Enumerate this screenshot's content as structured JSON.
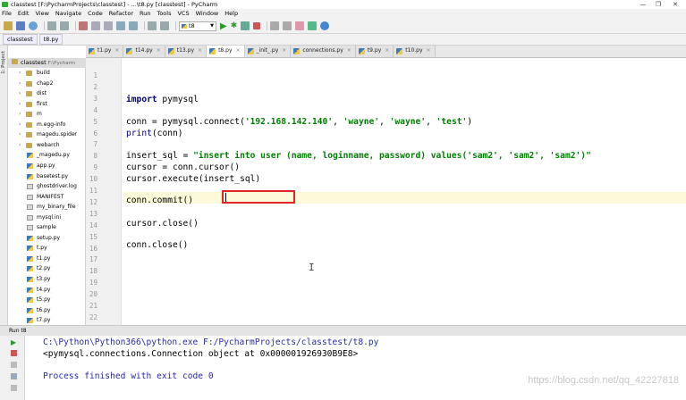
{
  "window": {
    "title": "classtest [F:\\PycharmProjects\\classtest] - ...\\t8.py [classtest] - PyCharm",
    "controls": [
      "—",
      "❐",
      "✕"
    ]
  },
  "menu": [
    "File",
    "Edit",
    "View",
    "Navigate",
    "Code",
    "Refactor",
    "Run",
    "Tools",
    "VCS",
    "Window",
    "Help"
  ],
  "toolbar": {
    "run_config": "t8"
  },
  "breadcrumbs": [
    "classtest",
    "t8.py"
  ],
  "left_strip": {
    "label": "1: Project"
  },
  "tabs": [
    {
      "label": "t1.py",
      "active": false
    },
    {
      "label": "t14.py",
      "active": false
    },
    {
      "label": "t13.py",
      "active": false
    },
    {
      "label": "t8.py",
      "active": true
    },
    {
      "label": "_init_.py",
      "active": false
    },
    {
      "label": "connections.py",
      "active": false
    },
    {
      "label": "t9.py",
      "active": false
    },
    {
      "label": "t10.py",
      "active": false
    }
  ],
  "project": {
    "root": "classtest",
    "root_path": "F:\\Pycharm",
    "items": [
      {
        "label": "build",
        "type": "folder"
      },
      {
        "label": "chap2",
        "type": "folder"
      },
      {
        "label": "dist",
        "type": "folder"
      },
      {
        "label": "first",
        "type": "folder"
      },
      {
        "label": "m",
        "type": "folder"
      },
      {
        "label": "m.egg-info",
        "type": "folder"
      },
      {
        "label": "magedu.spider",
        "type": "folder"
      },
      {
        "label": "webarch",
        "type": "folder"
      },
      {
        "label": "_magedu.py",
        "type": "py"
      },
      {
        "label": "app.py",
        "type": "py"
      },
      {
        "label": "basetest.py",
        "type": "py"
      },
      {
        "label": "ghostdriver.log",
        "type": "txt"
      },
      {
        "label": "MANIFEST",
        "type": "txt"
      },
      {
        "label": "my_binary_file",
        "type": "txt"
      },
      {
        "label": "mysql.ini",
        "type": "txt"
      },
      {
        "label": "sample",
        "type": "txt"
      },
      {
        "label": "setup.py",
        "type": "py"
      },
      {
        "label": "t.py",
        "type": "py"
      },
      {
        "label": "t1.py",
        "type": "py"
      },
      {
        "label": "t2.py",
        "type": "py"
      },
      {
        "label": "t3.py",
        "type": "py"
      },
      {
        "label": "t4.py",
        "type": "py"
      },
      {
        "label": "t5.py",
        "type": "py"
      },
      {
        "label": "t6.py",
        "type": "py"
      },
      {
        "label": "t7.py",
        "type": "py"
      }
    ]
  },
  "editor": {
    "line_numbers": [
      "1",
      "2",
      "3",
      "4",
      "5",
      "6",
      "7",
      "8",
      "9",
      "10",
      "11",
      "12",
      "13",
      "14",
      "15",
      "16",
      "17",
      "18",
      "19",
      "20",
      "21",
      "22"
    ],
    "code": {
      "l3_kw": "import",
      "l3_rest": " pymysql",
      "l5_a": "conn = pymysql.connect(",
      "l5_s1": "'192.168.142.140'",
      "l5_c1": ", ",
      "l5_s2": "'wayne'",
      "l5_c2": ", ",
      "l5_s3": "'wayne'",
      "l5_c3": ", ",
      "l5_s4": "'test'",
      "l5_end": ")",
      "l6_fn": "print",
      "l6_rest": "(conn)",
      "l8_a": "insert_sql = ",
      "l8_s": "\"insert into user (name, loginname, password) values('sam2', 'sam2', 'sam2')\"",
      "l9": "cursor = conn.cursor()",
      "l10": "cursor.execute(insert_sql)",
      "l12": "conn.commit()",
      "l14": "cursor.close()",
      "l16": "conn.close()"
    }
  },
  "run_panel": {
    "header": "Run  t8",
    "lines": [
      "C:\\Python\\Python366\\python.exe F:/PycharmProjects/classtest/t8.py",
      "<pymysql.connections.Connection object at 0x000001926930B9E8>",
      "",
      "Process finished with exit code 0"
    ],
    "colors": {
      "path": "#2a2aa8",
      "object": "#000000",
      "finished": "#2a2aa8"
    }
  },
  "watermark": "https://blog.csdn.net/qq_42227818"
}
